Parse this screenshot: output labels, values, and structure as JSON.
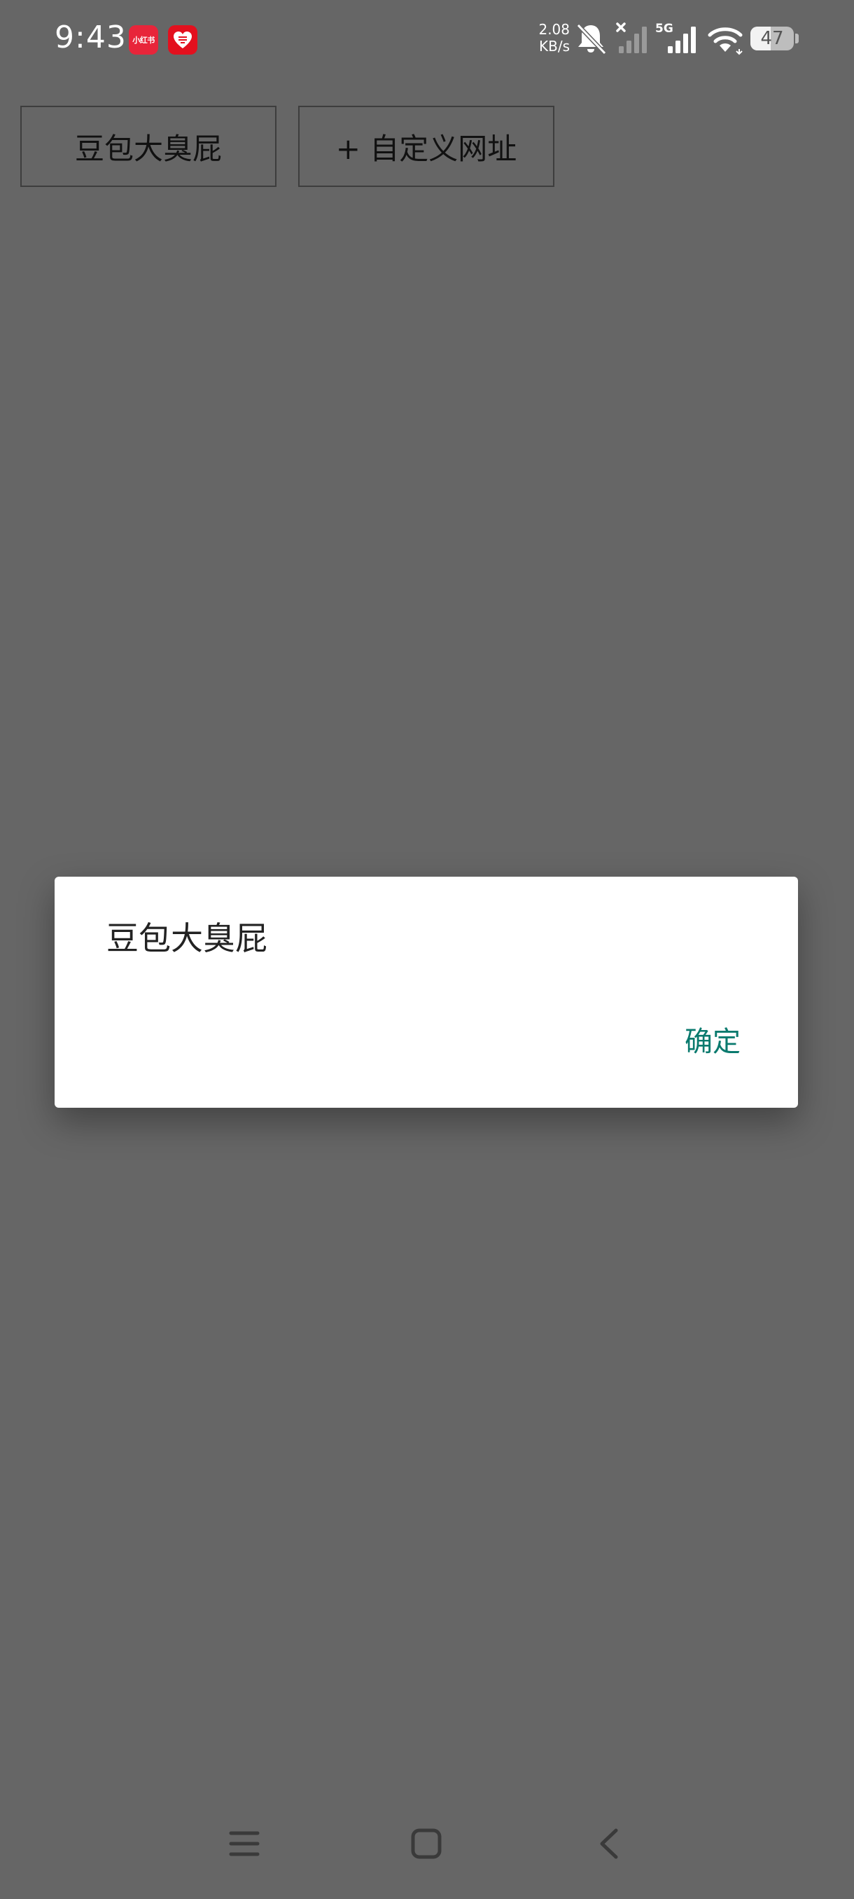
{
  "status_bar": {
    "time": "9:43",
    "app_badge_1": "小红书",
    "net_speed_value": "2.08",
    "net_speed_unit": "KB/s",
    "network_type": "5G",
    "battery_level": "47",
    "icons": [
      "xiaohongshu-app-icon",
      "heart-app-icon",
      "bell-mute-icon",
      "signal-no-service-icon",
      "signal-5g-icon",
      "wifi-icon",
      "battery-icon"
    ]
  },
  "buttons": {
    "doubao_label": "豆包大臭屁",
    "custom_url_label": "+ 自定义网址"
  },
  "dialog": {
    "message": "豆包大臭屁",
    "ok_label": "确定",
    "accent_color": "#0a7a6e"
  },
  "nav_bar": {
    "icons": [
      "menu-icon",
      "home-icon",
      "back-icon"
    ]
  },
  "colors": {
    "scrim_background": "#666666",
    "dialog_background": "#ffffff"
  }
}
